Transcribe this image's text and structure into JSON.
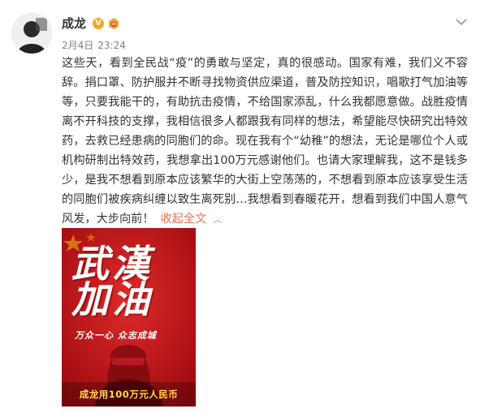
{
  "author": {
    "name": "成龙",
    "verified_badge": "V",
    "fan_badge_icon": "fan-badge-icon"
  },
  "meta": {
    "date": "2月4日",
    "time": "23:24"
  },
  "post": {
    "text": "这些天，看到全民战“疫”的勇敢与坚定，真的很感动。国家有难，我们义不容辞。捐口罩、防护服并不断寻找物资供应渠道，普及防控知识，唱歌打气加油等等，只要我能干的，有助抗击疫情，不给国家添乱，什么我都愿意做。战胜疫情离不开科技的支撑，我相信很多人都跟我有同样的想法，希望能尽快研究出特效药，去救已经患病的同胞们的命。现在我有个“幼稚”的想法，无论是哪位个人或机构研制出特效药，我想拿出100万元感谢他们。也请大家理解我，这不是钱多少，是我不想看到原本应该繁华的大街上空荡荡的，不想看到原本应该享受生活的同胞们被疾病纠缠以致生离死别…我想看到春暖花开，想看到我们中国人意气风发，大步向前！",
    "collapse_label": "收起全文",
    "collapse_icon": "chevron-up-icon"
  },
  "poster": {
    "title_line1": "武漢",
    "title_line2": "加油",
    "slogan": "万众一心  众志成城",
    "bottom_text": "成龙用100万元人民币"
  },
  "colors": {
    "link": "#eb7350",
    "poster_red": "#c1121a",
    "badge_orange": "#f5a623",
    "poster_yellow": "#ffd84a"
  }
}
